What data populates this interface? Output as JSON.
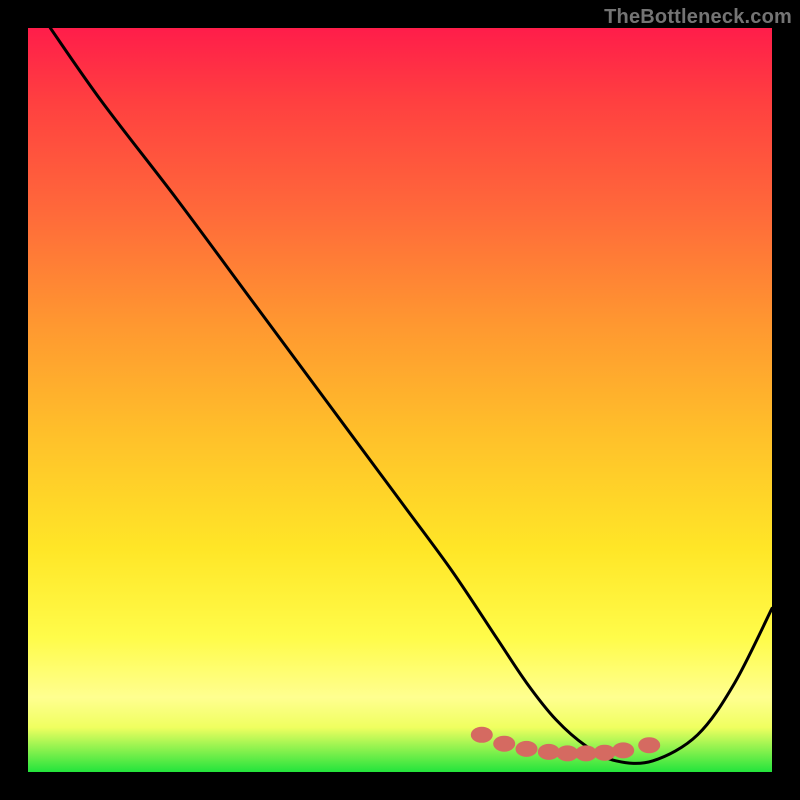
{
  "watermark": "TheBottleneck.com",
  "chart_data": {
    "type": "line",
    "title": "",
    "xlabel": "",
    "ylabel": "",
    "xlim": [
      0,
      100
    ],
    "ylim": [
      0,
      100
    ],
    "series": [
      {
        "name": "curve",
        "x": [
          3,
          10,
          20,
          30,
          40,
          50,
          57,
          63,
          67,
          71,
          75,
          79,
          84,
          90,
          95,
          100
        ],
        "values": [
          100,
          90,
          77,
          63.5,
          50,
          36.5,
          27,
          18,
          12,
          7,
          3.5,
          1.5,
          1.5,
          5,
          12,
          22
        ]
      }
    ],
    "markers": {
      "name": "dots",
      "x": [
        61,
        64,
        67,
        70,
        72.5,
        75,
        77.5,
        80,
        83.5
      ],
      "values": [
        5,
        3.8,
        3.1,
        2.7,
        2.5,
        2.5,
        2.6,
        2.9,
        3.6
      ]
    },
    "colors": {
      "curve": "#000000",
      "markers": "#d56a61",
      "gradient_start": "#ff1d4a",
      "gradient_end": "#23e43c"
    }
  }
}
